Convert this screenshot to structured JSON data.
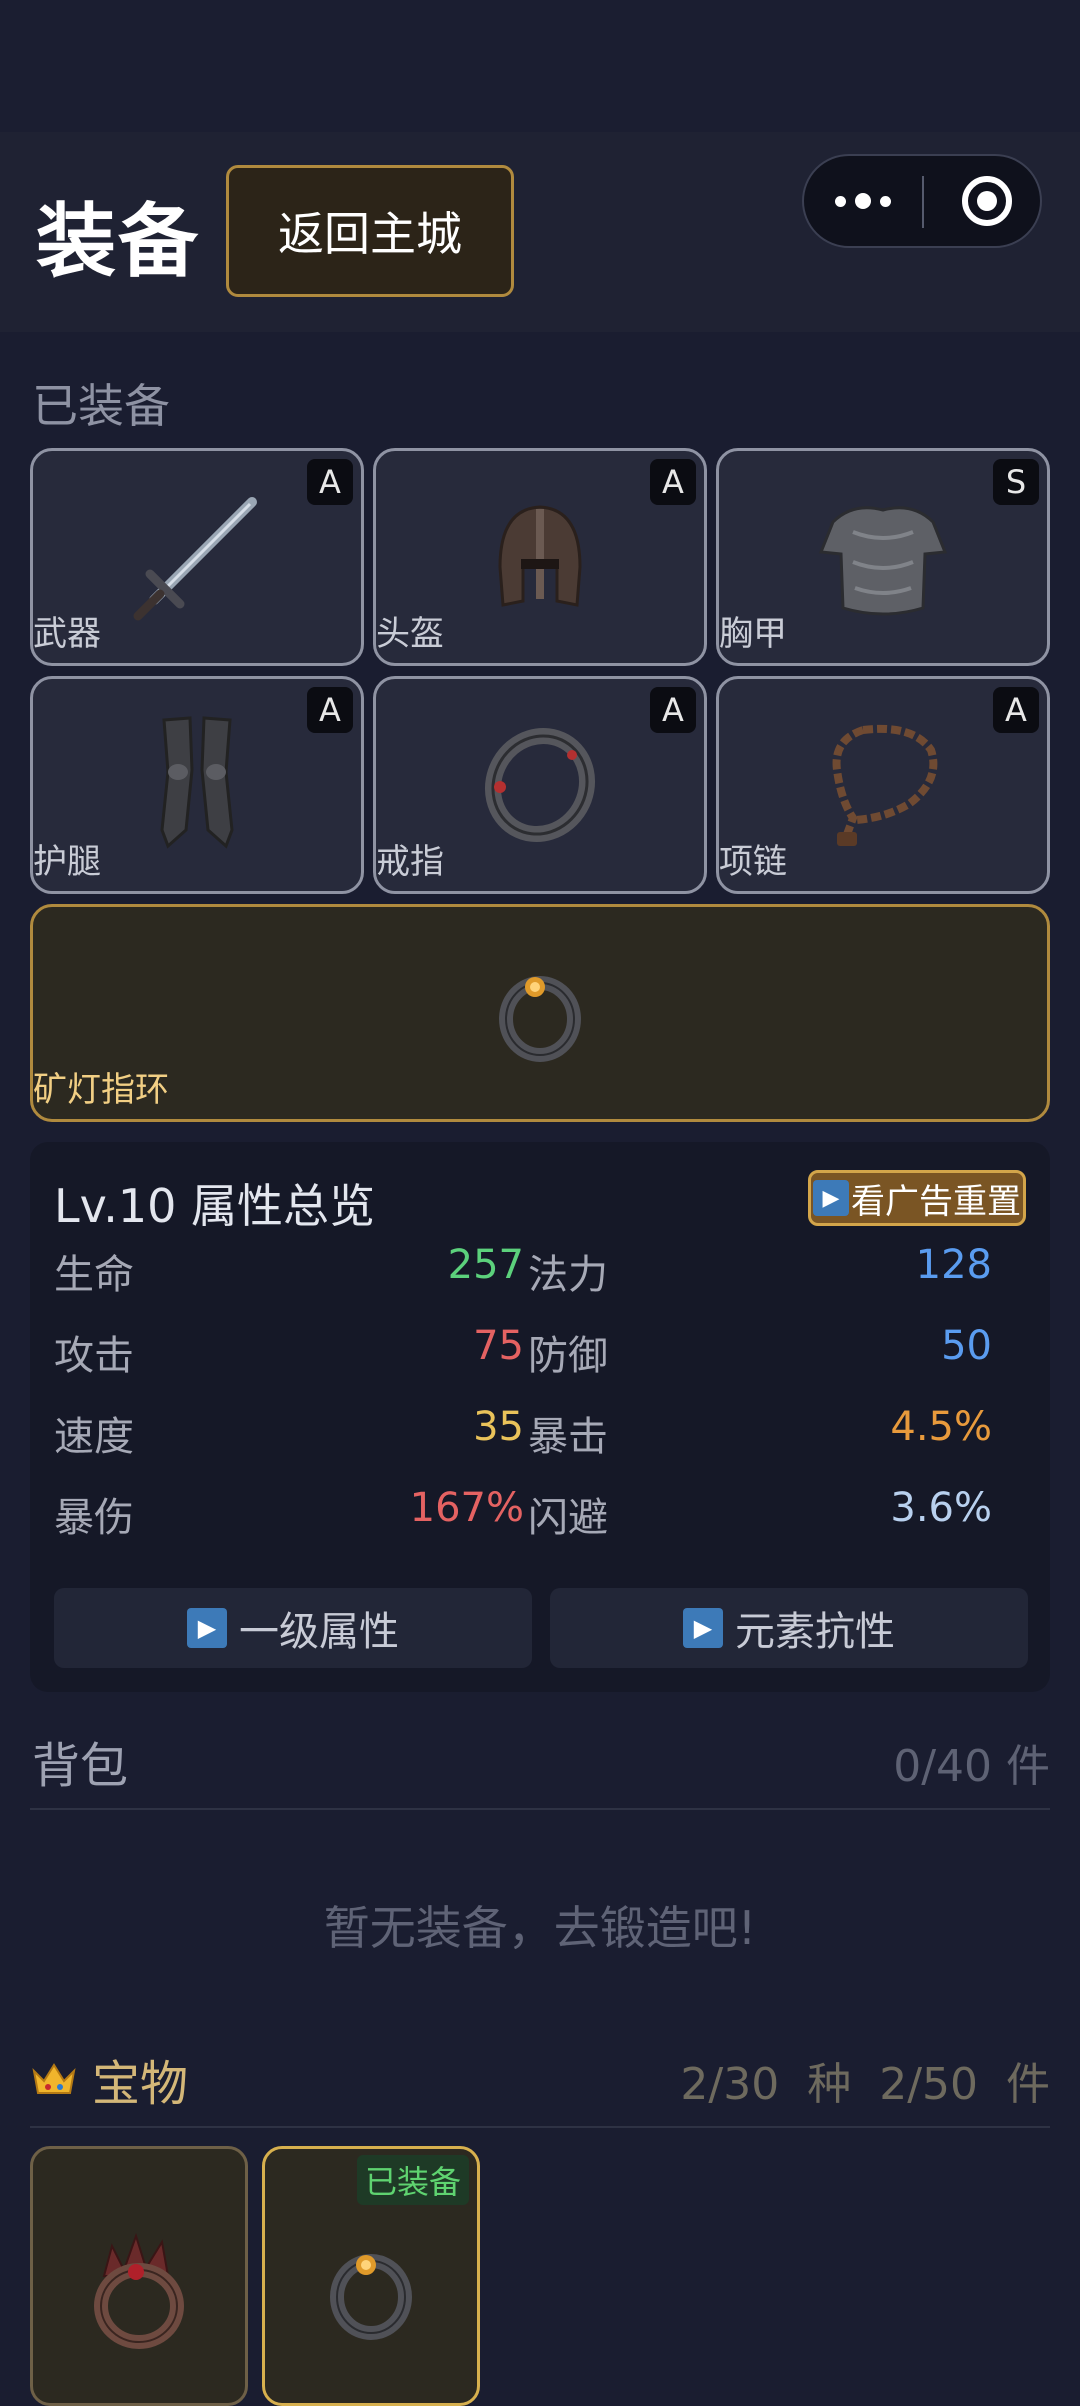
{
  "header": {
    "title": "装备",
    "back_label": "返回主城",
    "capsule": {
      "more_icon": "more-dots-icon",
      "close_icon": "target-circle-icon"
    }
  },
  "equipped": {
    "label": "已装备",
    "slots": [
      {
        "name": "武器",
        "grade": "A",
        "icon": "sword-icon"
      },
      {
        "name": "头盔",
        "grade": "A",
        "icon": "helmet-icon"
      },
      {
        "name": "胸甲",
        "grade": "S",
        "icon": "chest-armor-icon"
      },
      {
        "name": "护腿",
        "grade": "A",
        "icon": "leg-armor-icon"
      },
      {
        "name": "戒指",
        "grade": "A",
        "icon": "ring-icon"
      },
      {
        "name": "项链",
        "grade": "A",
        "icon": "necklace-icon"
      }
    ],
    "accessory": {
      "name": "矿灯指环",
      "icon": "lamp-ring-icon"
    }
  },
  "stats": {
    "title": "Lv.10 属性总览",
    "ad_button": "看广告重置",
    "rows": [
      {
        "k1": "生命",
        "v1": "257",
        "k2": "法力",
        "v2": "128"
      },
      {
        "k1": "攻击",
        "v1": "75",
        "k2": "防御",
        "v2": "50"
      },
      {
        "k1": "速度",
        "v1": "35",
        "k2": "暴击",
        "v2": "4.5%"
      },
      {
        "k1": "暴伤",
        "v1": "167%",
        "k2": "闪避",
        "v2": "3.6%"
      }
    ],
    "value_colors": {
      "hp": "#5cd17c",
      "mp": "#5a9cf0",
      "atk": "#e46262",
      "def": "#5a9cf0",
      "spd": "#e9c25a",
      "crit": "#e89a3c",
      "critdmg": "#e46262",
      "dodge": "#b8d0ee"
    },
    "buttons": [
      "一级属性",
      "元素抗性"
    ]
  },
  "bag": {
    "title": "背包",
    "count": "0/40 件",
    "empty_text": "暂无装备，去锻造吧!"
  },
  "treasure": {
    "title": "宝物",
    "icon": "crown-icon",
    "count": "2/30 种  2/50 件",
    "items": [
      {
        "icon": "spiked-ring-icon",
        "tag": ""
      },
      {
        "icon": "lamp-ring-icon",
        "tag": "已装备"
      }
    ]
  }
}
